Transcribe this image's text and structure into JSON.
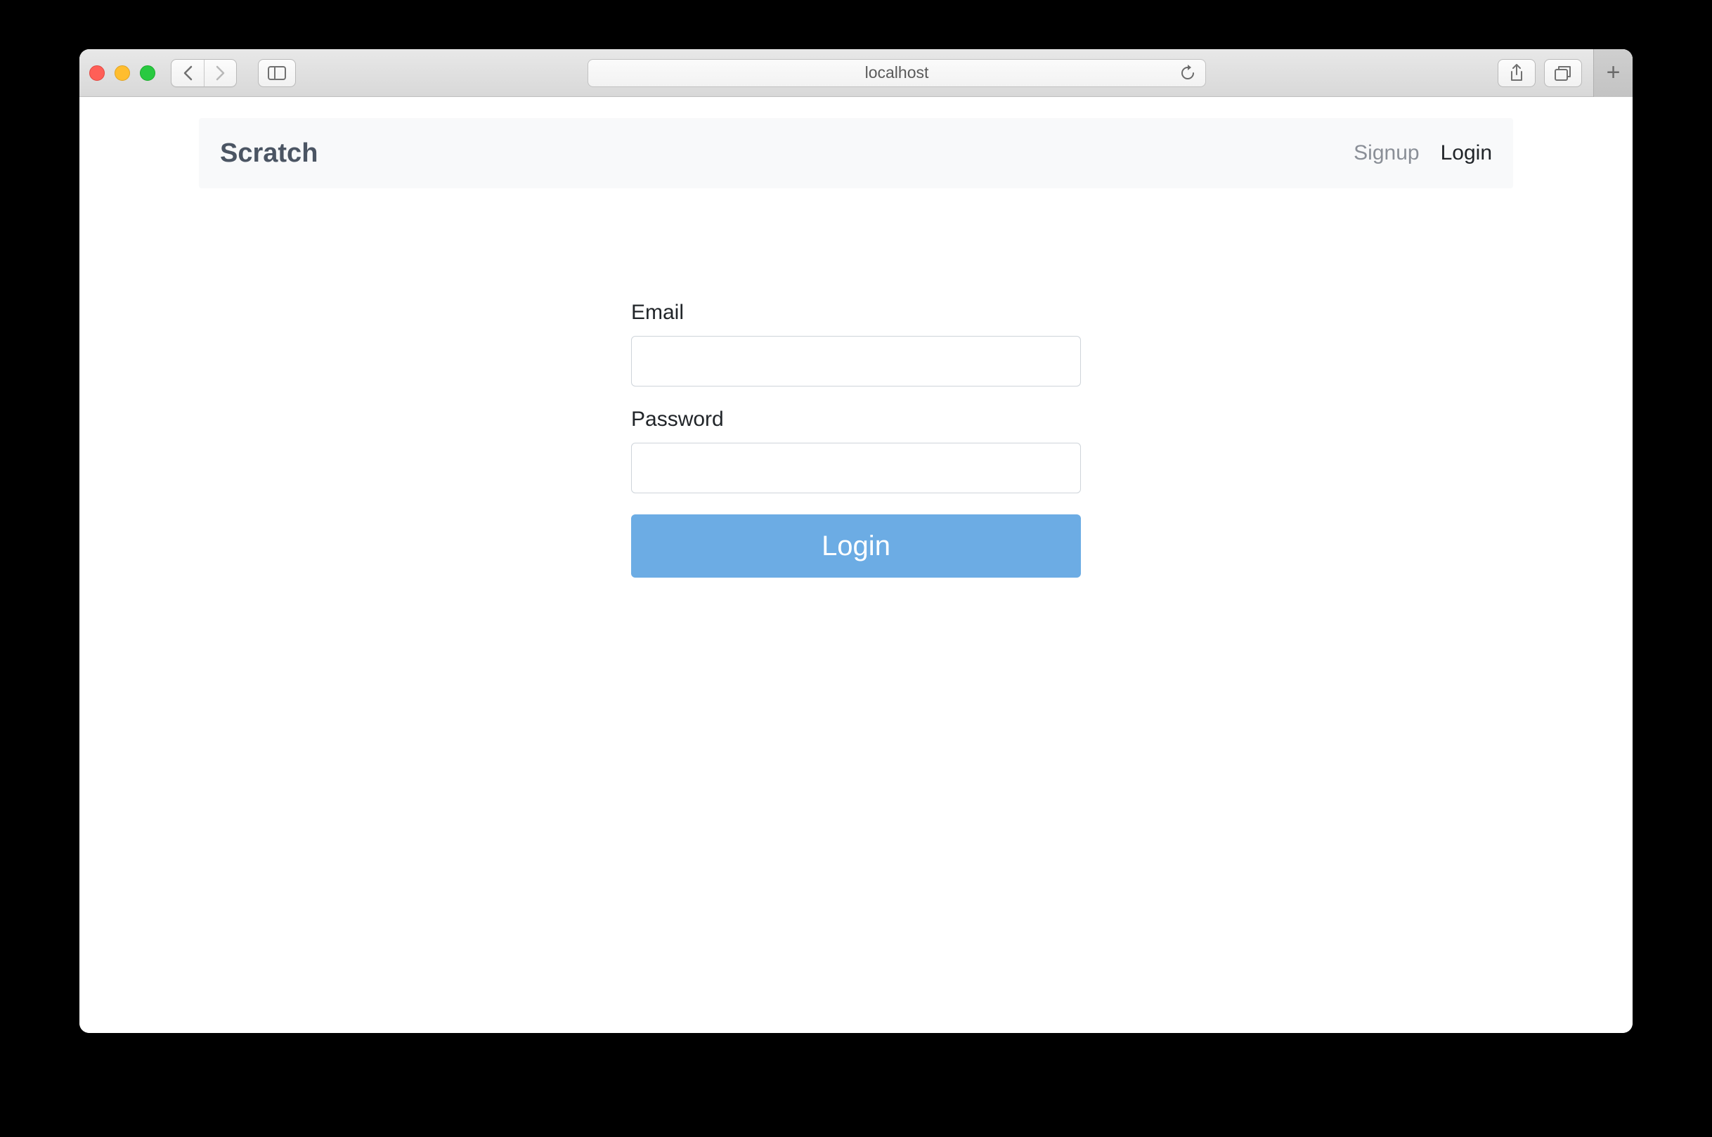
{
  "browser": {
    "address": "localhost"
  },
  "navbar": {
    "brand": "Scratch",
    "signup": "Signup",
    "login": "Login"
  },
  "form": {
    "emailLabel": "Email",
    "emailValue": "",
    "passwordLabel": "Password",
    "passwordValue": "",
    "submitLabel": "Login"
  }
}
